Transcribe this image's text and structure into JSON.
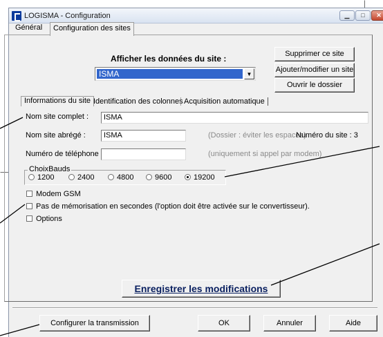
{
  "window": {
    "title": "LOGISMA - Configuration"
  },
  "tabs": {
    "general": "Général",
    "sites": "Configuration des sites"
  },
  "site": {
    "heading": "Afficher les données du site :",
    "selected": "ISMA",
    "delete_button": "Supprimer ce site",
    "add_button": "Ajouter/modifier un site",
    "open_button": "Ouvrir le dossier"
  },
  "subtabs": {
    "info": "Informations du site",
    "columns": "Identification des colonnes",
    "acquisition": "Acquisition automatique"
  },
  "form": {
    "full_name_label": "Nom site complet :",
    "full_name_value": "ISMA",
    "short_name_label": "Nom site abrégé :",
    "short_name_value": "ISMA",
    "short_name_hint": "(Dossier : éviter les espaces)",
    "site_number": "Numéro du site : 3",
    "phone_label": "Numéro de téléphone :",
    "phone_value": "",
    "phone_hint": "(uniquement si appel par modem)",
    "bauds_label": "ChoixBauds",
    "bauds": [
      "1200",
      "2400",
      "4800",
      "9600",
      "19200"
    ],
    "bauds_selected": "19200",
    "modem_gsm": "Modem GSM",
    "no_memory": "Pas de mémorisation en secondes (l'option doit être activée sur le convertisseur).",
    "options": "Options"
  },
  "footer": {
    "save": "Enregistrer les modifications",
    "transmission": "Configurer la transmission",
    "ok": "OK",
    "cancel": "Annuler",
    "help": "Aide"
  }
}
